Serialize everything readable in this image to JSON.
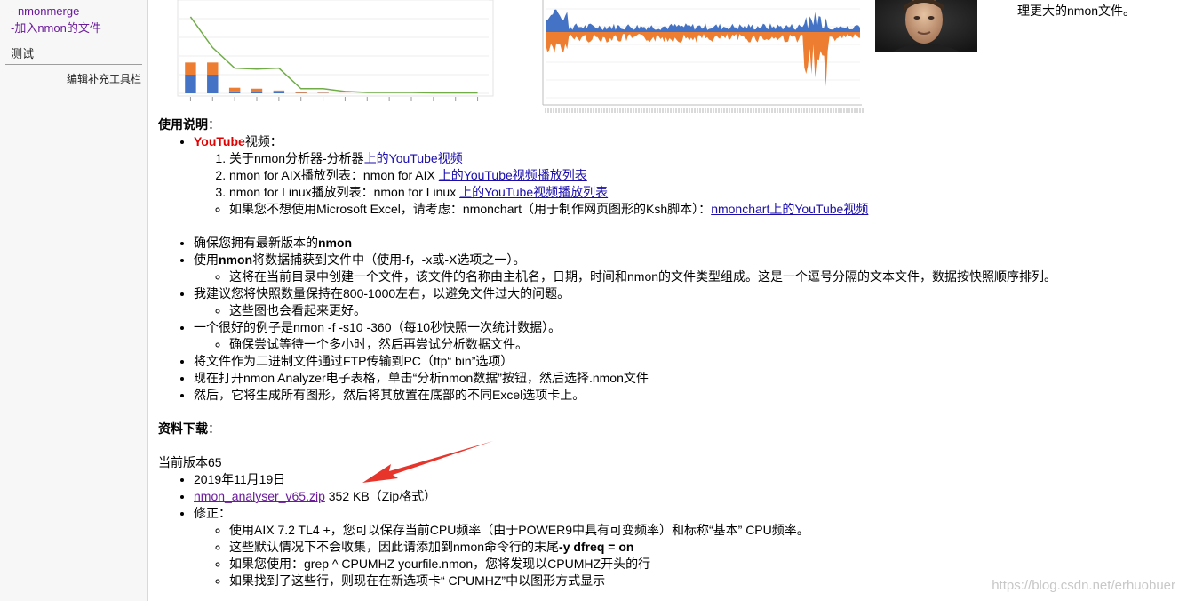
{
  "sidebar": {
    "merge_link": "- nmonmerge",
    "add_link": "-加入nmon的文件",
    "test_label": "测试",
    "edit_toolbar": "编辑补充工具栏"
  },
  "side_text": "理更大的nmon文件。",
  "usage": {
    "heading": "使用说明",
    "heading_colon": "：",
    "youtube_label": "YouTube",
    "video_suffix": "视频：",
    "ol_items": [
      {
        "text": "关于nmon分析器-分析器",
        "link": "上的YouTube视频"
      },
      {
        "text": "nmon for AIX播放列表：nmon for AIX ",
        "link": "上的YouTube视频播放列表"
      },
      {
        "text": "nmon for Linux播放列表：nmon for Linux ",
        "link": "上的YouTube视频播放列表"
      }
    ],
    "excel_note": "如果您不想使用Microsoft Excel，请考虑：nmonchart（用于制作网页图形的Ksh脚本）：",
    "excel_link": "nmonchart上的YouTube视频",
    "bullets": {
      "b1_pre": "确保您拥有最新版本的",
      "b1_bold": "nmon",
      "b2_pre": "使用",
      "b2_bold": "nmon",
      "b2_post": "将数据捕获到文件中（使用-f，-x或-X选项之一）。",
      "b2_sub": "这将在当前目录中创建一个文件，该文件的名称由主机名，日期，时间和nmon的文件类型组成。这是一个逗号分隔的文本文件，数据按快照顺序排列。",
      "b3": "我建议您将快照数量保持在800-1000左右，以避免文件过大的问题。",
      "b3_sub": "这些图也会看起来更好。",
      "b4": "一个很好的例子是nmon -f -s10 -360（每10秒快照一次统计数据）。",
      "b4_sub": "确保尝试等待一个多小时，然后再尝试分析数据文件。",
      "b5": "将文件作为二进制文件通过FTP传输到PC（ftp“ bin”选项）",
      "b6": "现在打开nmon Analyzer电子表格，单击“分析nmon数据”按钮，然后选择.nmon文件",
      "b7": "然后，它将生成所有图形，然后将其放置在底部的不同Excel选项卡上。"
    }
  },
  "download": {
    "heading": "资料下载",
    "heading_colon": "：",
    "version": "当前版本65",
    "date": "2019年11月19日",
    "file_link": "nmon_analyser_v65.zip",
    "file_info": " 352 KB（Zip格式）",
    "fix_label": "修正：",
    "fixes": {
      "f1": "使用AIX 7.2 TL4 +，您可以保存当前CPU频率（由于POWER9中具有可变频率）和标称“基本” CPU频率。",
      "f2_pre": "这些默认情况下不会收集，因此请添加到nmon命令行的末尾",
      "f2_bold": "-y dfreq = on",
      "f3": "如果您使用：grep ^ CPUMHZ yourfile.nmon，您将发现以CPUMHZ开头的行",
      "f4": "如果找到了这些行，则现在在新选项卡“ CPUMHZ”中以图形方式显示"
    }
  },
  "watermark": "https://blog.csdn.net/erhuobuer",
  "colors": {
    "bar_orange": "#ed7d31",
    "bar_blue": "#4472c4",
    "line_green": "#70ad47",
    "arrow_red": "#e8352c"
  },
  "chart_data": [
    {
      "type": "bar",
      "stacked": true,
      "series": [
        {
          "values": [
            20,
            20,
            2,
            1.5,
            1.5,
            0.3,
            0.3,
            0,
            0,
            0,
            0,
            0,
            0,
            0
          ]
        },
        {
          "values": [
            13,
            13,
            4,
            3.5,
            1.5,
            0.8,
            0.4,
            0.1,
            0,
            0,
            0,
            0,
            0,
            0
          ]
        }
      ],
      "line": [
        82,
        49,
        27,
        26,
        27,
        5,
        5,
        2,
        1,
        1,
        1,
        0.5,
        0.5,
        0.5
      ],
      "grid": true
    },
    {
      "type": "area",
      "note_series": "positive blue, negative orange",
      "spike_positions": [
        0.02,
        0.86
      ],
      "grid": true
    }
  ]
}
